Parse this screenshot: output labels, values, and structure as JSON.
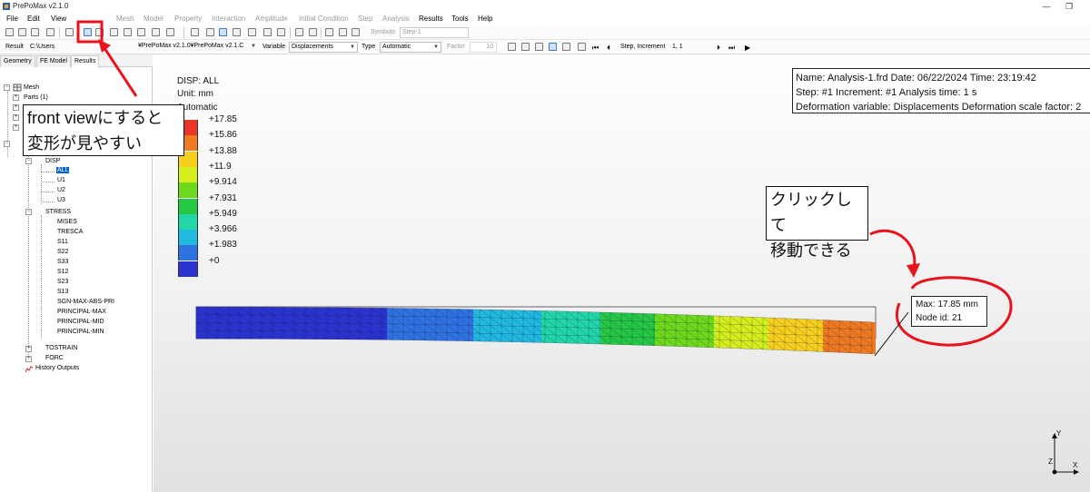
{
  "window": {
    "title": "PrePoMax v2.1.0"
  },
  "menu": [
    "File",
    "Edit",
    "View",
    "Geometry",
    "Mesh",
    "Model",
    "Property",
    "Interaction",
    "Amplitude",
    "Initial Condition",
    "Step",
    "Analysis",
    "Results",
    "Tools",
    "Help"
  ],
  "toolbar1": {
    "symbols_label": "Symbols",
    "step_select": "Step-1"
  },
  "toolbar2": {
    "result_label": "Result",
    "result_path": "C:\\Users",
    "result_file": "¥PrePoMax v2.1.0¥PrePoMax v2.1.C",
    "variable_label": "Variable",
    "variable_value": "Displacements",
    "type_label": "Type",
    "type_value": "Automatic",
    "factor_label": "Factor",
    "factor_value": "10",
    "increment_label": "Step, Increment",
    "increment_value": "1, 1"
  },
  "tabs": [
    "Geometry",
    "FE Model",
    "Results"
  ],
  "tree": {
    "mesh": "Mesh",
    "parts": "Parts (1)",
    "disp": "DISP",
    "all": "ALL",
    "u1": "U1",
    "u2": "U2",
    "u3": "U3",
    "stress": "STRESS",
    "stress_items": [
      "MISES",
      "TRESCA",
      "S11",
      "S22",
      "S33",
      "S12",
      "S23",
      "S13",
      "SGN-MAX-ABS-PRI",
      "PRINCIPAL-MAX",
      "PRINCIPAL-MID",
      "PRINCIPAL-MIN"
    ],
    "tostrain": "TOSTRAIN",
    "forc": "FORC",
    "history": "History Outputs"
  },
  "legend": {
    "title": "DISP: ALL",
    "unit": "Unit: mm",
    "mode": "Automatic",
    "values": [
      "+17.85",
      "+15.86",
      "+13.88",
      "+11.9",
      "+9.914",
      "+7.931",
      "+5.949",
      "+3.966",
      "+1.983",
      "+0"
    ],
    "colors": [
      "#e8362a",
      "#f07a22",
      "#f7cf1d",
      "#d5ee1d",
      "#6ed91d",
      "#25c844",
      "#22d6a8",
      "#21b9e0",
      "#2f72e2",
      "#2b33cf"
    ]
  },
  "info": {
    "line1": "Name: Analysis-1.frd  Date: 06/22/2024  Time: 23:19:42",
    "line2": "Step: #1  Increment: #1  Analysis time: 1 s",
    "line3": "Deformation variable: Displacements  Deformation scale factor: 2"
  },
  "annotation_front": {
    "line1": "front viewにすると",
    "line2": "変形が見やすい"
  },
  "annotation_click": {
    "line1": "クリックして",
    "line2": "移動できる"
  },
  "max_label": {
    "line1": "Max: 17.85 mm",
    "line2": "Node id: 21"
  },
  "axes": {
    "y": "Y",
    "z": "Z",
    "x": "X"
  },
  "colors": {
    "annotation_red": "#e8141d",
    "selection_blue": "#0a64c8"
  }
}
